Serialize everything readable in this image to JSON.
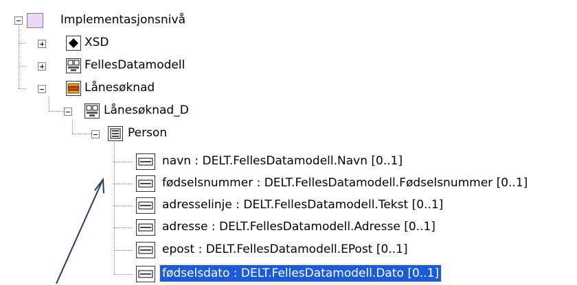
{
  "tree": {
    "root": {
      "label": "Implementasjonsnivå",
      "icon": "package-icon",
      "state": "expanded"
    },
    "xsd": {
      "label": "XSD",
      "icon": "diamond-icon",
      "state": "collapsed"
    },
    "felles": {
      "label": "FellesDatamodell",
      "icon": "diagram-icon",
      "state": "collapsed"
    },
    "lanesoknad": {
      "label": "Lånesøknad",
      "icon": "component-icon",
      "state": "expanded"
    },
    "lanesoknad_d": {
      "label": "Lånesøknad_D",
      "icon": "diagram-icon",
      "state": "expanded"
    },
    "person": {
      "label": "Person",
      "icon": "class-icon",
      "state": "expanded"
    },
    "attributes": [
      {
        "label": "navn : DELT.FellesDatamodell.Navn [0..1]",
        "icon": "attribute-icon"
      },
      {
        "label": "fødselsnummer : DELT.FellesDatamodell.Fødselsnummer [0..1]",
        "icon": "attribute-icon"
      },
      {
        "label": "adresselinje : DELT.FellesDatamodell.Tekst [0..1]",
        "icon": "attribute-icon"
      },
      {
        "label": "adresse : DELT.FellesDatamodell.Adresse [0..1]",
        "icon": "attribute-icon"
      },
      {
        "label": "epost : DELT.FellesDatamodell.EPost [0..1]",
        "icon": "attribute-icon"
      },
      {
        "label": "fødselsdato : DELT.FellesDatamodell.Dato [0..1]",
        "icon": "attribute-icon",
        "selected": true
      }
    ]
  },
  "colors": {
    "selection": "#1c5bd6",
    "arrow": "#1f3c6e"
  }
}
